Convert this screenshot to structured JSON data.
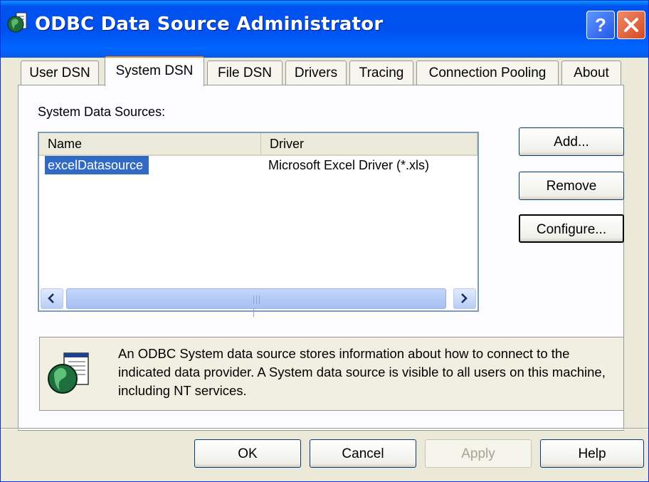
{
  "window": {
    "title": "ODBC Data Source Administrator",
    "help_glyph": "?",
    "icon": "odbc-globe-icon"
  },
  "tabs": [
    {
      "label": "User DSN",
      "active": false
    },
    {
      "label": "System DSN",
      "active": true
    },
    {
      "label": "File DSN",
      "active": false
    },
    {
      "label": "Drivers",
      "active": false
    },
    {
      "label": "Tracing",
      "active": false
    },
    {
      "label": "Connection Pooling",
      "active": false
    },
    {
      "label": "About",
      "active": false
    }
  ],
  "panel": {
    "section_label": "System Data Sources:",
    "columns": [
      "Name",
      "Driver"
    ],
    "rows": [
      {
        "name": "excelDatasource",
        "driver": "Microsoft Excel Driver (*.xls)",
        "selected": true
      }
    ],
    "buttons": {
      "add": "Add...",
      "remove": "Remove",
      "configure": "Configure..."
    },
    "info": "An ODBC System data source stores information about how to connect to the indicated data provider.   A System data source is visible to all users on this machine, including NT services."
  },
  "footer": {
    "ok": "OK",
    "cancel": "Cancel",
    "apply": "Apply",
    "help": "Help"
  },
  "colors": {
    "titlebar": "#0053ee",
    "selection": "#316ac5",
    "tab_highlight": "#e68b2c"
  }
}
